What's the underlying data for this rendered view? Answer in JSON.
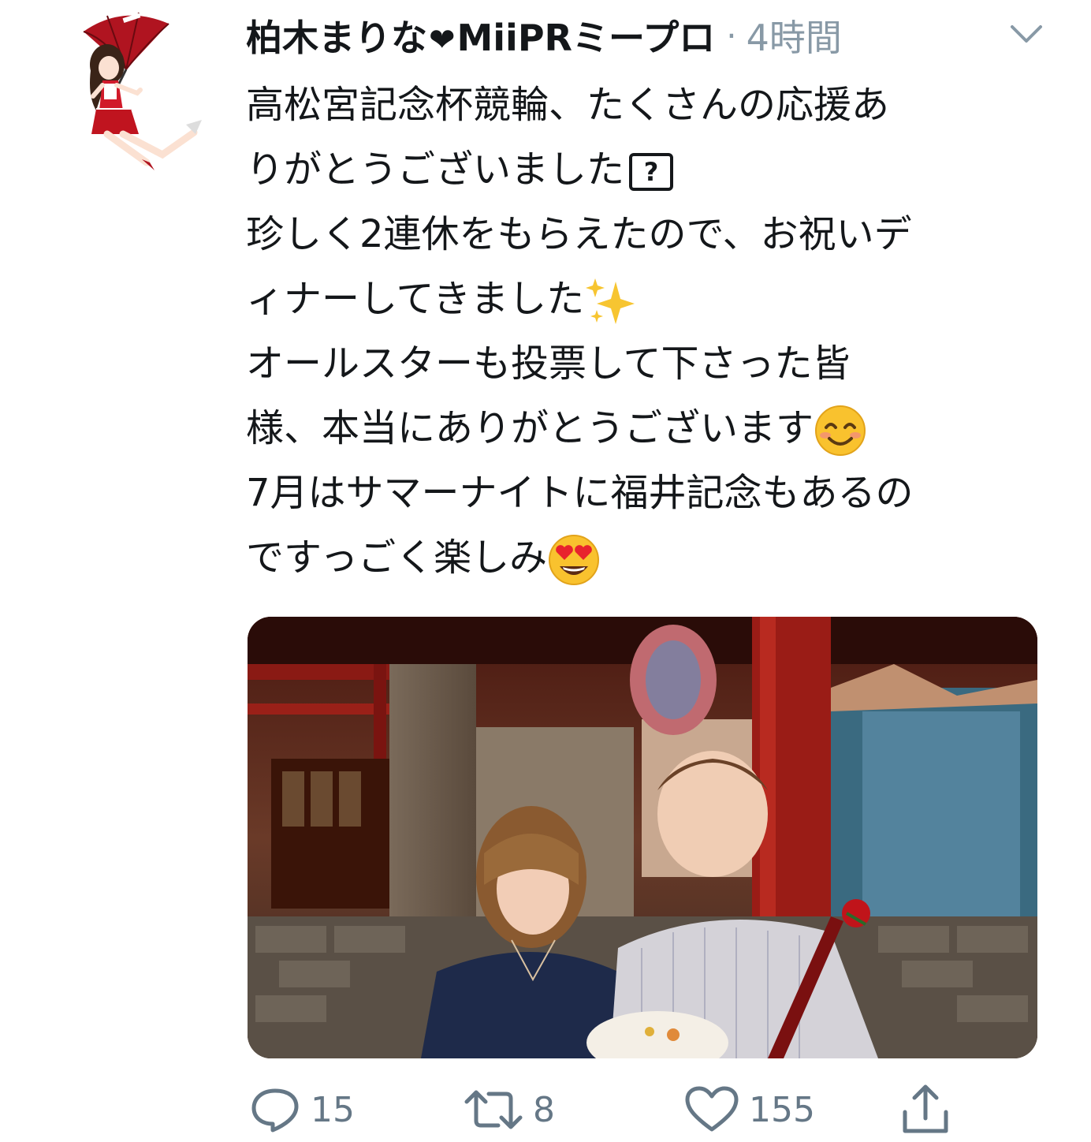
{
  "tweet": {
    "author": {
      "name_part1": "柏木まりな",
      "heart_glyph": "❤",
      "name_part2": "MiiPRミープロ",
      "avatar_icon": "avatar-illustration-umbrella"
    },
    "separator": "·",
    "timestamp": "4時間",
    "menu_icon": "chevron-down-icon",
    "body_lines": [
      "高松宮記念杯競輪、たくさんの応援あ",
      "りがとうございました",
      "珍しく2連休をもらえたので、お祝いデ",
      "ィナーしてきました",
      "オールスターも投票して下さった皆",
      "様、本当にありがとうございます",
      "7月はサマーナイトに福井記念もあるの",
      "ですっごく楽しみ"
    ],
    "unknown_char_glyph": "?",
    "emojis": {
      "line4": "sparkles",
      "line6": "smiling-face-with-smiling-eyes",
      "line8": "smiling-face-with-heart-eyes"
    },
    "photo": {
      "icon": "photo-restaurant-couple"
    },
    "actions": {
      "reply_count": "15",
      "retweet_count": "8",
      "like_count": "155"
    }
  },
  "colors": {
    "text": "#14171a",
    "muted": "#8899a6",
    "action": "#657786"
  }
}
